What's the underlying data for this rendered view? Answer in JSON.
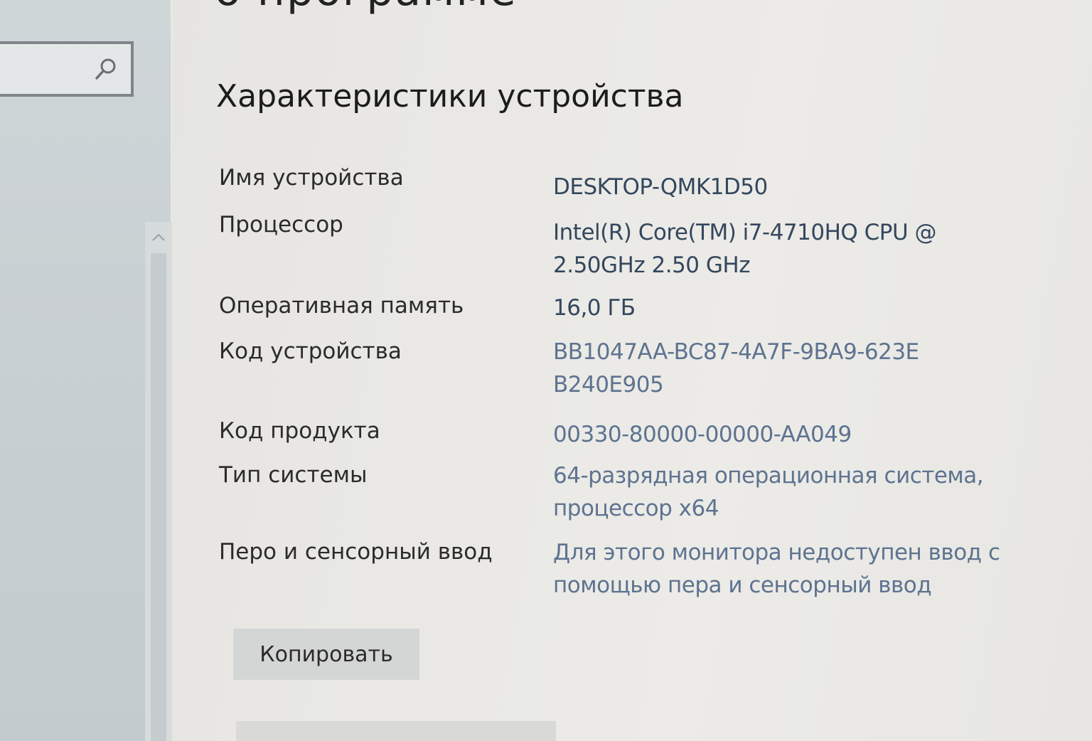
{
  "header": {
    "previous_section_title": "о программе"
  },
  "search": {
    "placeholder": ""
  },
  "device_specs": {
    "title": "Характеристики устройства",
    "rows": [
      {
        "label": "Имя устройства",
        "value": "DESKTOP-QMK1D50"
      },
      {
        "label": "Процессор",
        "value": "Intel(R) Core(TM) i7-4710HQ CPU @ 2.50GHz   2.50 GHz"
      },
      {
        "label": "Оперативная память",
        "value": "16,0 ГБ"
      },
      {
        "label": "Код устройства",
        "value": "BB1047AA-BC87-4A7F-9BA9-623EB240E905"
      },
      {
        "label": "Код продукта",
        "value": "00330-80000-00000-AA049"
      },
      {
        "label": "Тип системы",
        "value": "64-разрядная операционная система, процессор x64"
      },
      {
        "label": "Перо и сенсорный ввод",
        "value": "Для этого монитора недоступен ввод с помощью пера и сенсорный ввод"
      }
    ],
    "copy_label": "Копировать"
  },
  "colors": {
    "label_text": "#2b2b2b",
    "value_text": "#34475e",
    "button_bg": "#d4d6d5"
  }
}
